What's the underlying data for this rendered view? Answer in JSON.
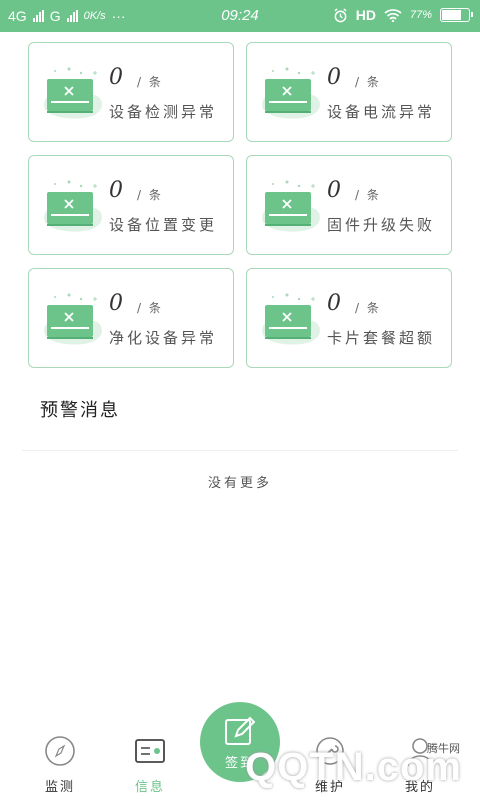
{
  "status_bar": {
    "network_left": "4G",
    "network_right": "G",
    "speed": "0K/s",
    "dots": "···",
    "time": "09:24",
    "hd": "HD",
    "battery_text": "77%",
    "battery_level": 0.77
  },
  "cards": [
    {
      "count": "0",
      "unit": "/ 条",
      "label": "设备检测异常"
    },
    {
      "count": "0",
      "unit": "/ 条",
      "label": "设备电流异常"
    },
    {
      "count": "0",
      "unit": "/ 条",
      "label": "设备位置变更"
    },
    {
      "count": "0",
      "unit": "/ 条",
      "label": "固件升级失败"
    },
    {
      "count": "0",
      "unit": "/ 条",
      "label": "净化设备异常"
    },
    {
      "count": "0",
      "unit": "/ 条",
      "label": "卡片套餐超额"
    }
  ],
  "section": {
    "title": "预警消息"
  },
  "list": {
    "empty_text": "没有更多"
  },
  "nav": {
    "monitor": "监测",
    "info": "信息",
    "checkin": "签到",
    "maintain": "维护",
    "mine": "我的"
  },
  "watermark": {
    "logo": "QQTN.com",
    "small": "腾牛网"
  },
  "colors": {
    "accent": "#6cc48b",
    "card_border": "#a9d9b9"
  }
}
